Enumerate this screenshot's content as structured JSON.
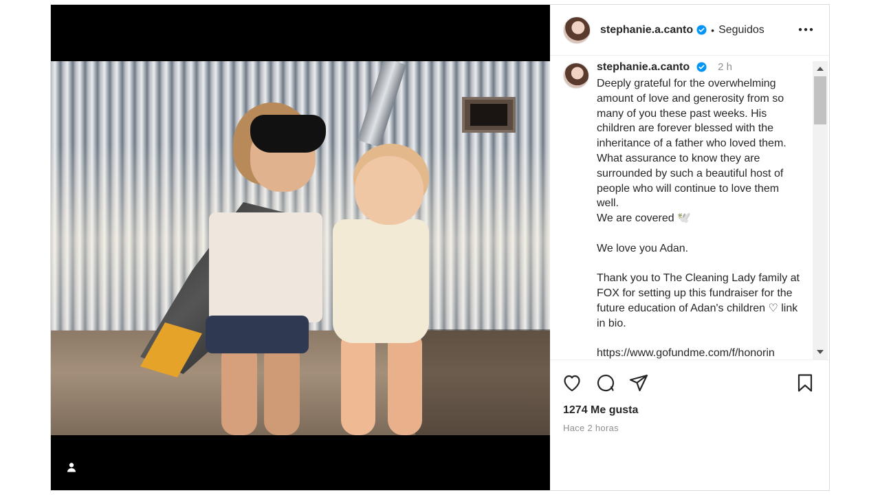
{
  "post": {
    "username": "stephanie.a.canto",
    "follow_status": "Seguidos",
    "separator": "•",
    "time_short": "2 h",
    "caption": "Deeply grateful for the overwhelming amount of love and generosity from so many of you these past weeks. His children are forever blessed with the inheritance of a father who loved them. What assurance to know they are surrounded by such a beautiful host of people who will continue to love them well.\nWe are covered 🕊️\n\nWe love you Adan.\n\nThank you to The Cleaning Lady family at FOX for setting up this fundraiser for the future education of Adan's children ♡ link in bio.\n\nhttps://www.gofundme.com/f/honorin",
    "likes": "1274 Me gusta",
    "posted_ago": "Hace 2 horas"
  },
  "icons": {
    "more": "more-options-icon",
    "verified": "verified-badge-icon",
    "like": "heart-icon",
    "comment": "comment-icon",
    "share": "paper-plane-icon",
    "save": "bookmark-icon",
    "tags": "user-tag-icon"
  },
  "colors": {
    "verified": "#0095f6",
    "text": "#262626",
    "muted": "#8e8e8e",
    "media_bg": "#000000"
  }
}
